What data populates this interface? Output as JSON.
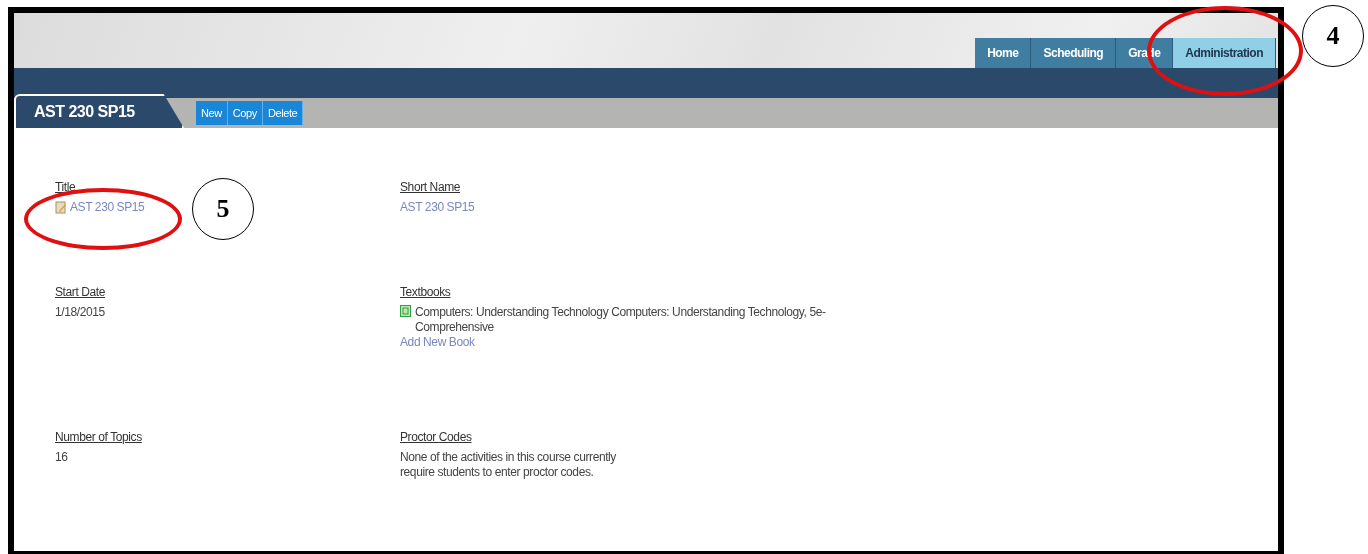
{
  "nav_tabs": [
    {
      "label": "Home",
      "selected": false
    },
    {
      "label": "Scheduling",
      "selected": false
    },
    {
      "label": "Grade",
      "selected": false
    },
    {
      "label": "Administration",
      "selected": true
    }
  ],
  "course_tab": {
    "label": "AST 230 SP15"
  },
  "actions": [
    "New",
    "Copy",
    "Delete"
  ],
  "fields": [
    {
      "label": "Title",
      "kind": "edit_link",
      "value": "AST 230 SP15"
    },
    {
      "label": "Short Name",
      "kind": "link",
      "value": "AST 230 SP15"
    },
    {
      "label": "Start Date",
      "kind": "text",
      "value": "1/18/2015"
    },
    {
      "label": "Textbooks",
      "kind": "books",
      "value": "Computers: Understanding Technology Computers: Understanding Technology, 5e-Comprehensive",
      "link": "Add New Book"
    },
    {
      "label": "Number of Topics",
      "kind": "text",
      "value": "16"
    },
    {
      "label": "Proctor Codes",
      "kind": "note",
      "value": "None of the activities in this course currently require students to enter proctor codes."
    }
  ],
  "callouts": [
    {
      "label": "4"
    },
    {
      "label": "5"
    }
  ]
}
